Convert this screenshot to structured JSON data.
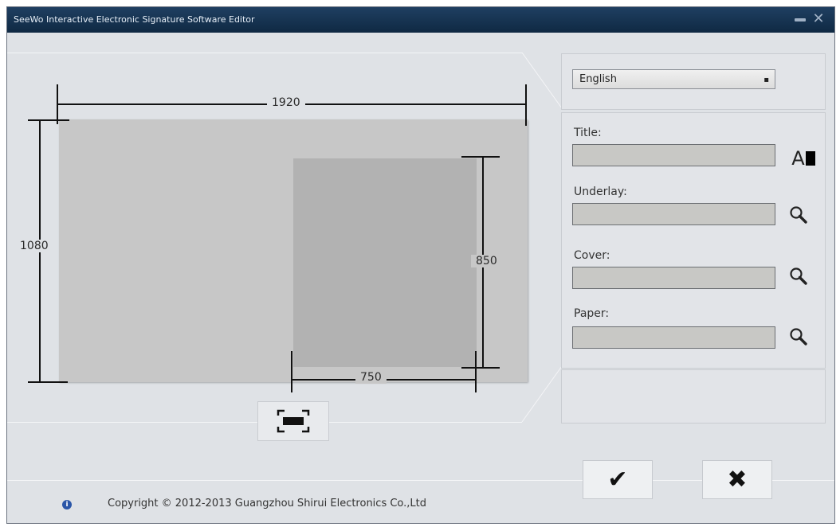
{
  "window": {
    "title": "SeeWo Interactive Electronic Signature Software Editor"
  },
  "preview": {
    "width_label": "1920",
    "height_label": "1080",
    "inner_height_label": "850",
    "inner_width_label": "750"
  },
  "language": {
    "selected": "English"
  },
  "fields": {
    "title_label": "Title:",
    "underlay_label": "Underlay:",
    "cover_label": "Cover:",
    "paper_label": "Paper:",
    "font_icon_letter": "A"
  },
  "actions": {
    "ok_symbol": "✔",
    "cancel_symbol": "✖"
  },
  "footer": {
    "copyright": "Copyright © 2012-2013 Guangzhou Shirui Electronics Co.,Ltd"
  },
  "icons": {
    "minimize": "minimize-icon",
    "close": "close-icon",
    "search": "magnifier-icon",
    "fit": "fit-screen-icon",
    "info": "info-icon",
    "font": "font-icon"
  },
  "colors": {
    "titlebar": "#14324f",
    "window_bg": "#dfe2e6",
    "canvas": "#c7c7c7",
    "inner_area": "#b2b2b2"
  }
}
